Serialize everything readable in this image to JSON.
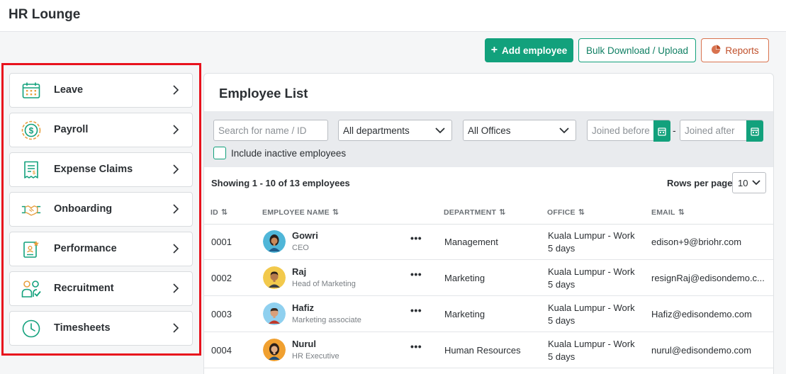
{
  "app": {
    "title": "HR Lounge"
  },
  "toolbar": {
    "add_label": "Add employee",
    "bulk_label": "Bulk Download / Upload",
    "reports_label": "Reports"
  },
  "sidebar": {
    "items": [
      {
        "label": "Leave",
        "icon": "calendar-icon"
      },
      {
        "label": "Payroll",
        "icon": "payroll-coin-icon"
      },
      {
        "label": "Expense Claims",
        "icon": "receipt-icon"
      },
      {
        "label": "Onboarding",
        "icon": "handshake-icon"
      },
      {
        "label": "Performance",
        "icon": "certificate-icon"
      },
      {
        "label": "Recruitment",
        "icon": "people-check-icon"
      },
      {
        "label": "Timesheets",
        "icon": "clock-icon"
      }
    ]
  },
  "list": {
    "title": "Employee List",
    "search_placeholder": "Search for name / ID",
    "department_value": "All departments",
    "office_value": "All Offices",
    "joined_before_placeholder": "Joined before",
    "joined_after_placeholder": "Joined after",
    "date_separator": "-",
    "inactive_label": "Include inactive employees",
    "showing": "Showing 1 - 10 of 13 employees",
    "rows_label": "Rows per page",
    "rows_value": "10",
    "columns": {
      "id": "ID",
      "name": "EMPLOYEE NAME",
      "department": "DEPARTMENT",
      "office": "OFFICE",
      "email": "EMAIL"
    },
    "row_menu": "•••",
    "rows": [
      {
        "id": "0001",
        "name": "Gowri",
        "title": "CEO",
        "department": "Management",
        "office_line1": "Kuala Lumpur - Work",
        "office_line2": "5 days",
        "email": "edison+9@briohr.com"
      },
      {
        "id": "0002",
        "name": "Raj",
        "title": "Head of Marketing",
        "department": "Marketing",
        "office_line1": "Kuala Lumpur - Work",
        "office_line2": "5 days",
        "email": "resignRaj@edisondemo.c..."
      },
      {
        "id": "0003",
        "name": "Hafiz",
        "title": "Marketing associate",
        "department": "Marketing",
        "office_line1": "Kuala Lumpur - Work",
        "office_line2": "5 days",
        "email": "Hafiz@edisondemo.com"
      },
      {
        "id": "0004",
        "name": "Nurul",
        "title": "HR Executive",
        "department": "Human Resources",
        "office_line1": "Kuala Lumpur - Work",
        "office_line2": "5 days",
        "email": "nurul@edisondemo.com"
      }
    ]
  },
  "colors": {
    "accent": "#12a17c",
    "highlight_border": "#e8121d",
    "reports": "#c0502b",
    "icon_orange": "#e8a040"
  }
}
